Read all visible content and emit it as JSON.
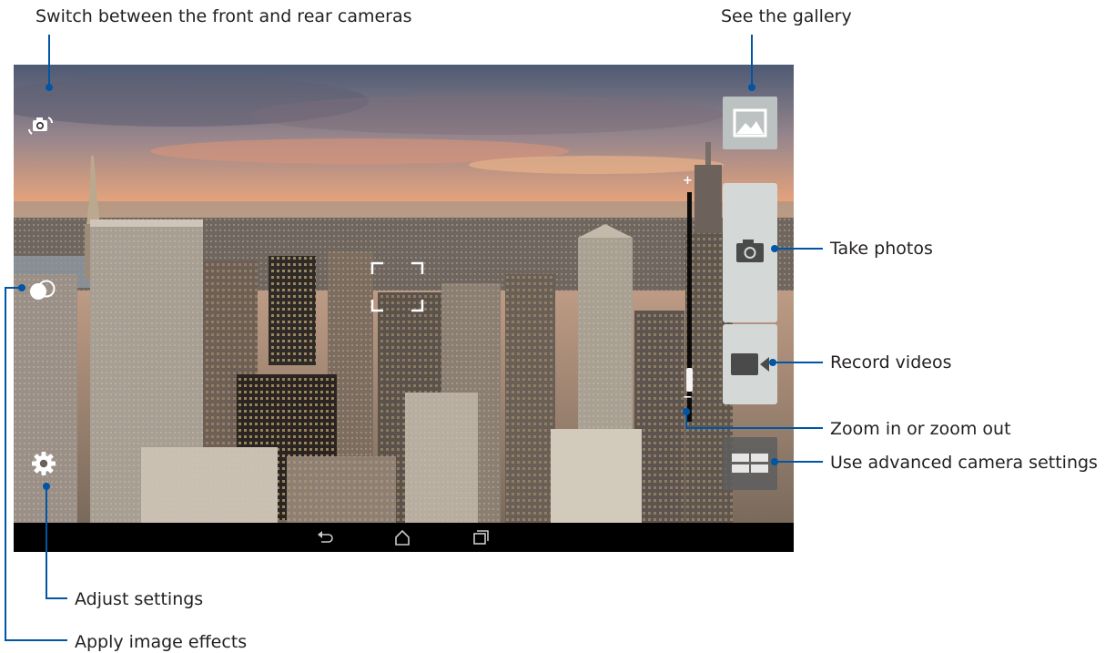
{
  "callouts": {
    "switch_camera": "Switch between the front and rear cameras",
    "gallery": "See the gallery",
    "take_photos": "Take photos",
    "record_videos": "Record videos",
    "zoom": "Zoom in or zoom out",
    "advanced_settings": "Use advanced camera settings",
    "adjust_settings": "Adjust settings",
    "image_effects": "Apply image effects"
  },
  "zoom": {
    "plus": "+",
    "minus": "−",
    "level": 0.1
  },
  "icons": {
    "switch_camera": "camera-switch-icon",
    "image_effects": "effects-icon",
    "settings": "gear-icon",
    "gallery": "image-icon",
    "shutter": "camera-icon",
    "record": "video-camera-icon",
    "advanced": "grid-icon",
    "back": "back-icon",
    "home": "home-icon",
    "recents": "recents-icon"
  },
  "colors": {
    "callout_line": "#0055a5",
    "panel": "#d4d9d8",
    "nav_bar": "#000000"
  }
}
